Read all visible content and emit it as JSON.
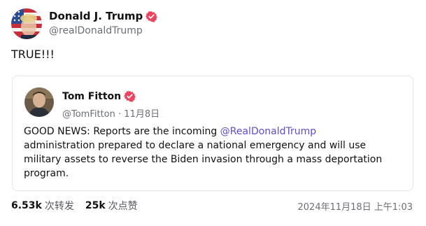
{
  "post": {
    "author_name": "Donald J. Trump",
    "author_handle": "@realDonaldTrump",
    "text": "TRUE!!!",
    "timestamp": "2024年11月18日 上午1:03"
  },
  "quote": {
    "author_name": "Tom Fitton",
    "author_handle": "@TomFitton",
    "date": "· 11月8日",
    "body_before": "GOOD NEWS: Reports are the incoming ",
    "mention": "@RealDonaldTrump",
    "body_after": " administration prepared to declare a national emergency and will use military assets to reverse the Biden invasion through a mass deportation program."
  },
  "stats": {
    "reposts_count": "6.53k",
    "reposts_label": "次转发",
    "likes_count": "25k",
    "likes_label": "次点赞"
  },
  "icons": {
    "verified": "verified-badge-icon"
  },
  "colors": {
    "verified_badge": "#e94560",
    "mention": "#5b50c9",
    "border": "#e3e5e8",
    "muted_text": "#6b6f76"
  }
}
